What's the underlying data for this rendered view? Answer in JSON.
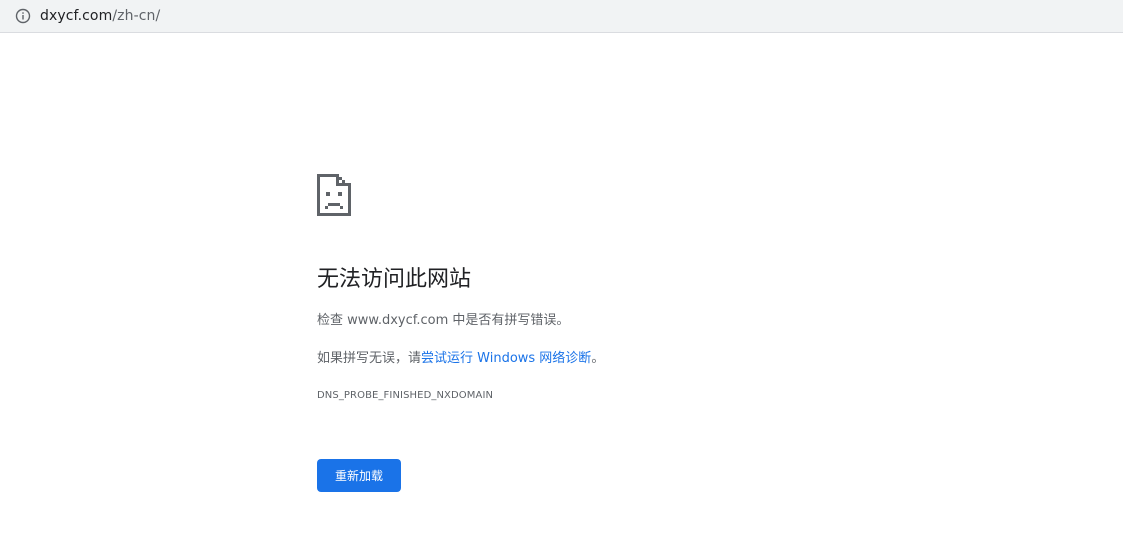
{
  "address_bar": {
    "host": "dxycf.com",
    "path": "/zh-cn/",
    "info_icon": "info-icon"
  },
  "error_page": {
    "icon": "sad-page-icon",
    "title": "无法访问此网站",
    "check_prefix": "检查 ",
    "check_domain": "www.dxycf.com",
    "check_suffix": " 中是否有拼写错误。",
    "spelling_prefix": "如果拼写无误，请",
    "diagnostics_link": "尝试运行 Windows 网络诊断",
    "spelling_suffix": "。",
    "error_code": "DNS_PROBE_FINISHED_NXDOMAIN",
    "reload_label": "重新加载"
  },
  "colors": {
    "accent": "#1a73e8",
    "text_primary": "#202124",
    "text_secondary": "#5f6368"
  }
}
